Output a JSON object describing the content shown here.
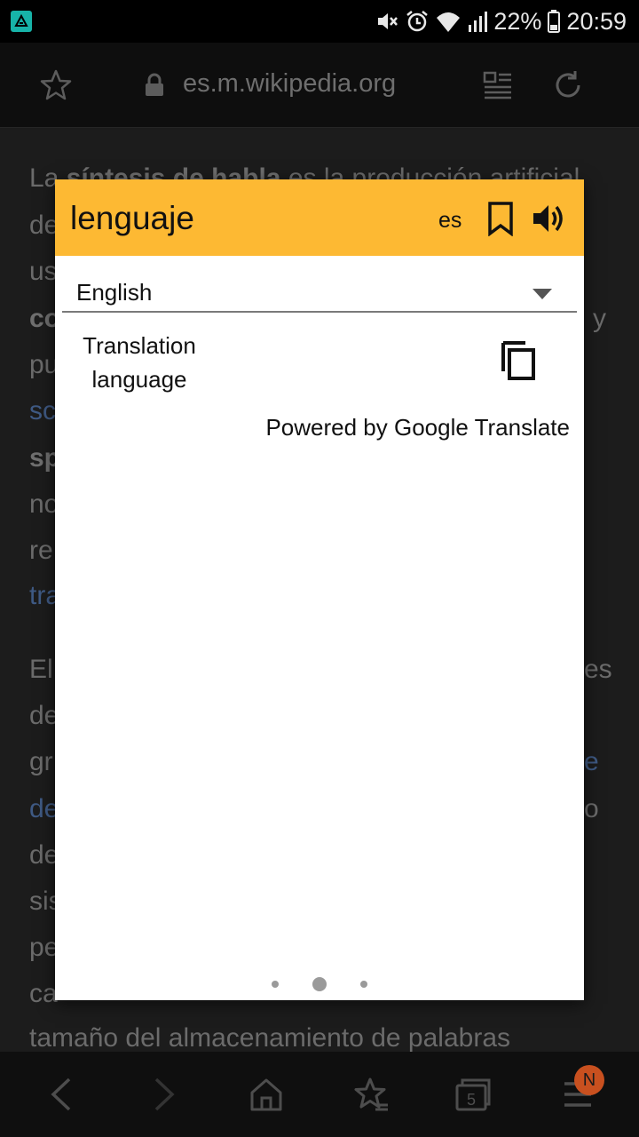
{
  "status_bar": {
    "battery": "22%",
    "time": "20:59"
  },
  "browser": {
    "url": "es.m.wikipedia.org"
  },
  "article": {
    "line1_prefix": "La ",
    "line1_bold": "síntesis de habla",
    "line1_rest": " es la producción artificial",
    "line2": "de",
    "line3": "us",
    "line4": "co",
    "line4_right": "y",
    "line5": "pu",
    "line6": "sc",
    "line7": "sp",
    "line8": "no",
    "line9": "re",
    "line10": "tra",
    "line11": "El",
    "line11_right": "es",
    "line12": "de",
    "line13": "gr",
    "line13_right": "e",
    "line14": "de",
    "line14_right": "o",
    "line15": "de",
    "line16": "sis",
    "line17": "pe",
    "line18": "ca",
    "line19": "tamaño del almacenamiento de palabras"
  },
  "dialog": {
    "word": "lenguaje",
    "source_lang": "es",
    "target_language": "English",
    "translation": "Translation language",
    "powered_by": "Powered by Google Translate",
    "page_indicator": {
      "count": 3,
      "active": 2
    }
  },
  "bottom_nav": {
    "tabs_count": "5",
    "notification_badge": "N"
  },
  "colors": {
    "header": "#fdb933",
    "badge": "#c8501f",
    "link": "#3f5a84"
  }
}
